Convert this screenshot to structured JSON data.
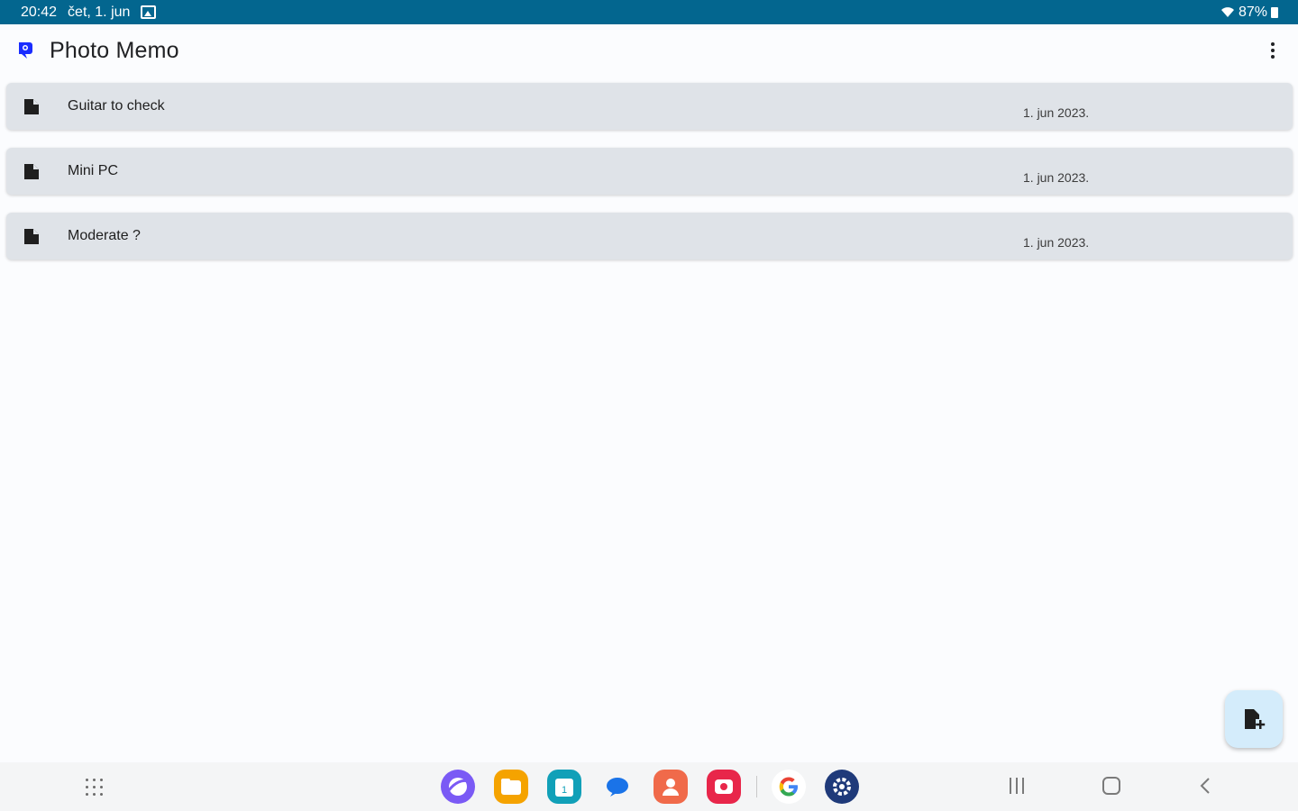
{
  "status_bar": {
    "time": "20:42",
    "date": "čet, 1. jun",
    "battery": "87%"
  },
  "app_bar": {
    "title": "Photo Memo"
  },
  "memos": [
    {
      "title": "Guitar to check",
      "date": "1. jun 2023."
    },
    {
      "title": "Mini PC",
      "date": "1. jun 2023."
    },
    {
      "title": "Moderate ?",
      "date": "1. jun 2023."
    }
  ],
  "colors": {
    "status_bar": "#03668f",
    "card": "#dfe3e8",
    "fab": "#d4ecfb",
    "logo": "#1a2cff"
  },
  "icons": {
    "app_logo": "photo-memo-logo-icon",
    "memo": "document-icon",
    "fab": "add-document-icon",
    "overflow": "more-vert-icon"
  },
  "dock_apps": [
    {
      "name": "internet",
      "color": "#7a5af5"
    },
    {
      "name": "my-files",
      "color": "#f5a300"
    },
    {
      "name": "calendar",
      "color": "#11a0b8"
    },
    {
      "name": "messages",
      "color": "#1a73e8"
    },
    {
      "name": "contacts",
      "color": "#f06a4a"
    },
    {
      "name": "screen-recorder",
      "color": "#e8264a"
    },
    {
      "name": "google",
      "color": "#ffffff"
    },
    {
      "name": "settings",
      "color": "#1f3a7a"
    }
  ]
}
